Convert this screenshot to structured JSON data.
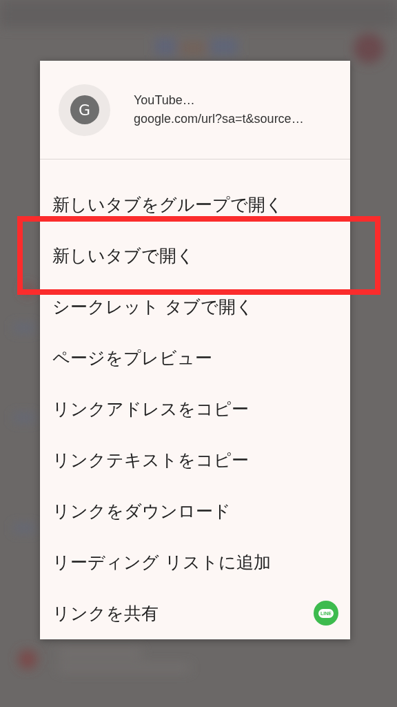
{
  "link_preview": {
    "icon_letter": "G",
    "title": "YouTube…",
    "url": "google.com/url?sa=t&source…"
  },
  "menu_items": [
    {
      "label": "新しいタブをグループで開く",
      "highlighted": false
    },
    {
      "label": "新しいタブで開く",
      "highlighted": true
    },
    {
      "label": "シークレット タブで開く",
      "highlighted": false
    },
    {
      "label": "ページをプレビュー",
      "highlighted": false
    },
    {
      "label": "リンクアドレスをコピー",
      "highlighted": false
    },
    {
      "label": "リンクテキストをコピー",
      "highlighted": false
    },
    {
      "label": "リンクをダウンロード",
      "highlighted": false
    },
    {
      "label": "リーディング リストに追加",
      "highlighted": false
    },
    {
      "label": "リンクを共有",
      "highlighted": false,
      "share_app": "LINE"
    }
  ]
}
